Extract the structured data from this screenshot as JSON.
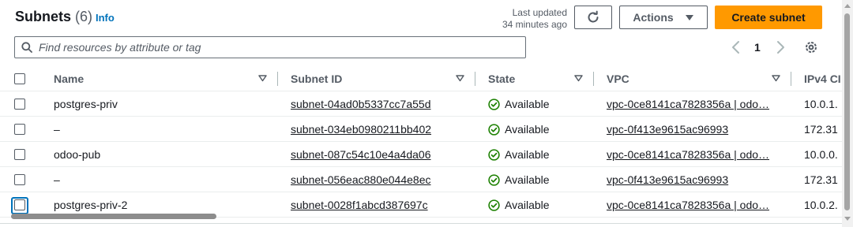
{
  "header": {
    "title": "Subnets",
    "count": "(6)",
    "info": "Info",
    "last_updated_line1": "Last updated",
    "last_updated_line2": "34 minutes ago",
    "actions_label": "Actions",
    "create_label": "Create subnet"
  },
  "filter": {
    "placeholder": "Find resources by attribute or tag"
  },
  "pagination": {
    "current_page": "1"
  },
  "columns": [
    "Name",
    "Subnet ID",
    "State",
    "VPC",
    "IPv4 CI"
  ],
  "rows": [
    {
      "name": "postgres-priv",
      "subnet_id": "subnet-04ad0b5337cc7a55d",
      "state": "Available",
      "vpc": "vpc-0ce8141ca7828356a | odo…",
      "ipv4": "10.0.1."
    },
    {
      "name": "–",
      "subnet_id": "subnet-034eb0980211bb402",
      "state": "Available",
      "vpc": "vpc-0f413e9615ac96993",
      "ipv4": "172.31"
    },
    {
      "name": "odoo-pub",
      "subnet_id": "subnet-087c54c10e4a4da06",
      "state": "Available",
      "vpc": "vpc-0ce8141ca7828356a | odo…",
      "ipv4": "10.0.0."
    },
    {
      "name": "–",
      "subnet_id": "subnet-056eac880e044e8ec",
      "state": "Available",
      "vpc": "vpc-0f413e9615ac96993",
      "ipv4": "172.31"
    },
    {
      "name": "postgres-priv-2",
      "subnet_id": "subnet-0028f1abcd387697c",
      "state": "Available",
      "vpc": "vpc-0ce8141ca7828356a | odo…",
      "ipv4": "10.0.2."
    }
  ],
  "colors": {
    "primary_button": "#ff9900",
    "link": "#0073bb",
    "success": "#1d8102"
  },
  "icons": {
    "refresh": "refresh-icon",
    "caret": "caret-down-icon",
    "search": "search-icon",
    "prev": "chevron-left-icon",
    "next": "chevron-right-icon",
    "settings": "gear-icon",
    "status": "check-circle-icon"
  }
}
